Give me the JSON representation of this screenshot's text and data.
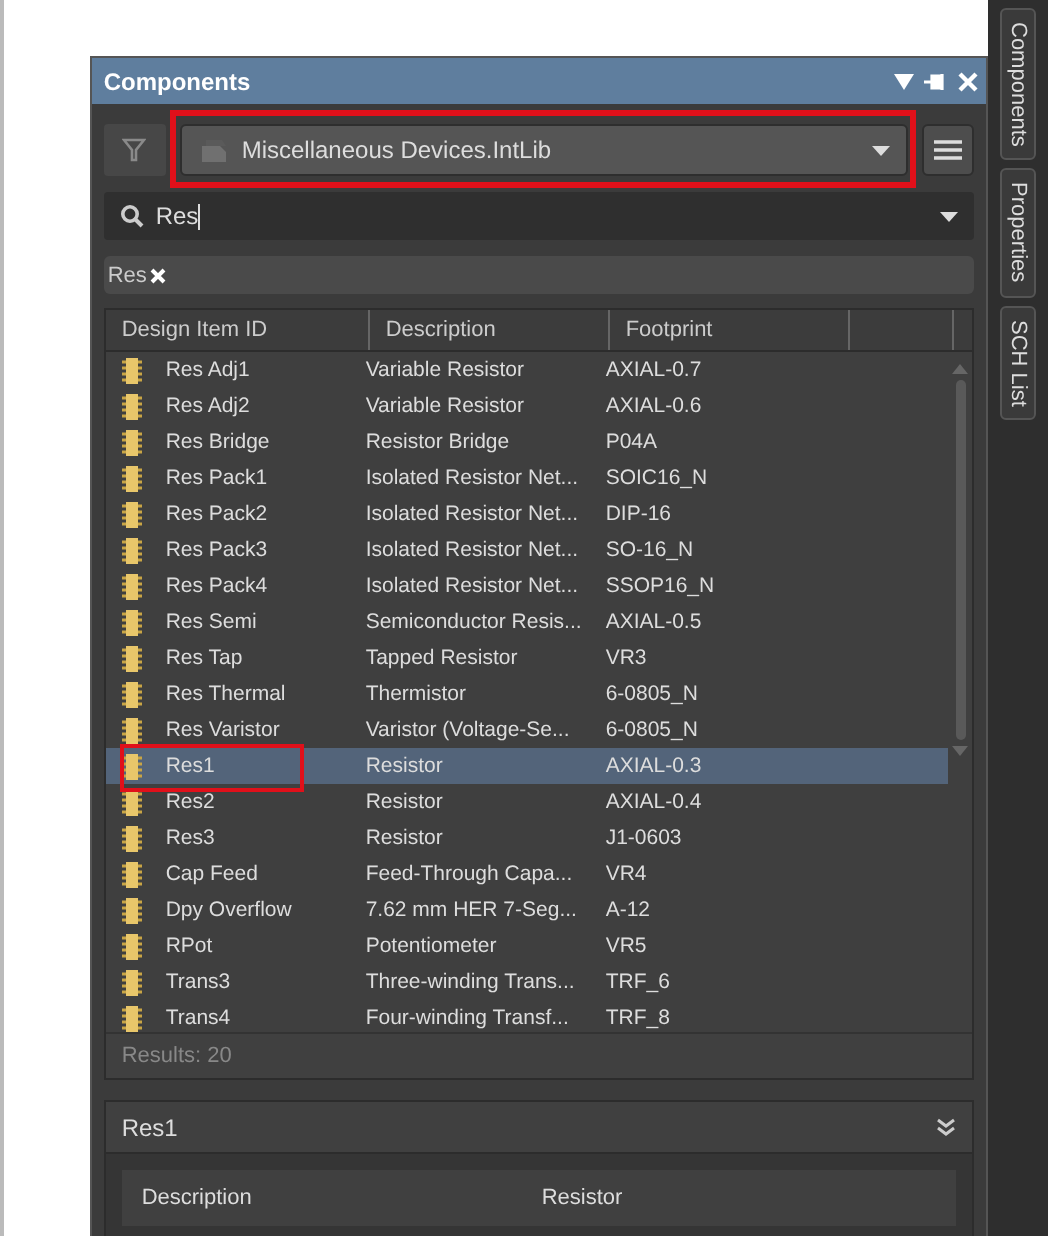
{
  "panel": {
    "title": "Components",
    "library": "Miscellaneous Devices.IntLib",
    "search": {
      "value": "Res"
    },
    "filter_tags": [
      {
        "label": "Res"
      }
    ]
  },
  "table": {
    "columns": [
      "Design Item ID",
      "Description",
      "Footprint"
    ],
    "rows": [
      {
        "cells": [
          "Res Adj1",
          "Variable Resistor",
          "AXIAL-0.7"
        ],
        "selected": false
      },
      {
        "cells": [
          "Res Adj2",
          "Variable Resistor",
          "AXIAL-0.6"
        ],
        "selected": false
      },
      {
        "cells": [
          "Res Bridge",
          "Resistor Bridge",
          "P04A"
        ],
        "selected": false
      },
      {
        "cells": [
          "Res Pack1",
          "Isolated Resistor Net...",
          "SOIC16_N"
        ],
        "selected": false
      },
      {
        "cells": [
          "Res Pack2",
          "Isolated Resistor Net...",
          "DIP-16"
        ],
        "selected": false
      },
      {
        "cells": [
          "Res Pack3",
          "Isolated Resistor Net...",
          "SO-16_N"
        ],
        "selected": false
      },
      {
        "cells": [
          "Res Pack4",
          "Isolated Resistor Net...",
          "SSOP16_N"
        ],
        "selected": false
      },
      {
        "cells": [
          "Res Semi",
          "Semiconductor Resis...",
          "AXIAL-0.5"
        ],
        "selected": false
      },
      {
        "cells": [
          "Res Tap",
          "Tapped Resistor",
          "VR3"
        ],
        "selected": false
      },
      {
        "cells": [
          "Res Thermal",
          "Thermistor",
          "6-0805_N"
        ],
        "selected": false
      },
      {
        "cells": [
          "Res Varistor",
          "Varistor (Voltage-Se...",
          "6-0805_N"
        ],
        "selected": false
      },
      {
        "cells": [
          "Res1",
          "Resistor",
          "AXIAL-0.3"
        ],
        "selected": true
      },
      {
        "cells": [
          "Res2",
          "Resistor",
          "AXIAL-0.4"
        ],
        "selected": false
      },
      {
        "cells": [
          "Res3",
          "Resistor",
          "J1-0603"
        ],
        "selected": false
      },
      {
        "cells": [
          "Cap Feed",
          "Feed-Through Capa...",
          "VR4"
        ],
        "selected": false
      },
      {
        "cells": [
          "Dpy Overflow",
          "7.62 mm HER 7-Seg...",
          "A-12"
        ],
        "selected": false
      },
      {
        "cells": [
          "RPot",
          "Potentiometer",
          "VR5"
        ],
        "selected": false
      },
      {
        "cells": [
          "Trans3",
          "Three-winding Trans...",
          "TRF_6"
        ],
        "selected": false
      },
      {
        "cells": [
          "Trans4",
          "Four-winding Transf...",
          "TRF_8"
        ],
        "selected": false
      }
    ]
  },
  "results": "Results: 20",
  "detail": {
    "title": "Res1",
    "fields": [
      {
        "label": "Description",
        "value": "Resistor"
      }
    ]
  },
  "side_tabs": [
    "Components",
    "Properties",
    "SCH List"
  ]
}
